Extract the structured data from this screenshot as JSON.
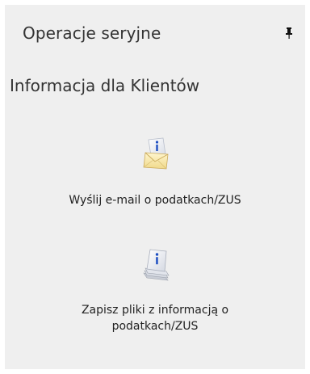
{
  "panel": {
    "title": "Operacje seryjne",
    "pin_icon": "pin-icon"
  },
  "section": {
    "title": "Informacja dla Klientów"
  },
  "actions": [
    {
      "label": "Wyślij e-mail o podatkach/ZUS",
      "icon": "info-envelope-icon"
    },
    {
      "label": "Zapisz pliki z informacją o podatkach/ZUS",
      "icon": "info-document-stack-icon"
    }
  ],
  "colors": {
    "panel_background": "#efefef",
    "info_blue": "#1e4fc2"
  }
}
